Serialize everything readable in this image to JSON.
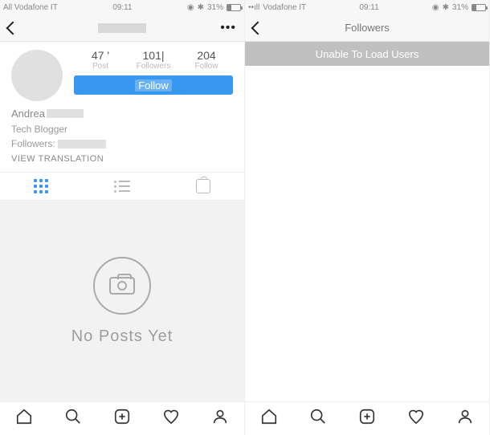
{
  "left": {
    "status": {
      "carrier": "All Vodafone IT",
      "time": "09:11",
      "battery": "31%"
    },
    "profile": {
      "stats": {
        "posts": {
          "value": "47 '",
          "label": "Post"
        },
        "followers": {
          "value": "101|",
          "label": "Followers"
        },
        "following": {
          "value": "204",
          "label": "Follow"
        }
      },
      "follow_btn": "Follow",
      "name": "Andrea",
      "tagline": "Tech Blogger",
      "followers_line": "Followers:",
      "translate": "VIEW TRANSLATION"
    },
    "empty": "No Posts Yet"
  },
  "right": {
    "status": {
      "carrier": "Vodafone IT",
      "time": "09:11",
      "battery": "31%"
    },
    "header_title": "Followers",
    "error": "Unable To Load Users"
  }
}
